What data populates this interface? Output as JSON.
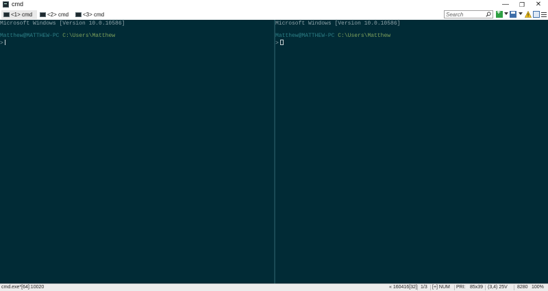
{
  "window": {
    "title": "cmd",
    "controls": {
      "minimize": "—",
      "maximize": "❐",
      "close": "✕"
    }
  },
  "tabs": [
    {
      "label": "<1> cmd",
      "active": true
    },
    {
      "label": "<2> cmd",
      "active": false
    },
    {
      "label": "<3> cmd",
      "active": false
    }
  ],
  "toolbar": {
    "search_placeholder": "Search",
    "icons": [
      "new-console-icon",
      "dropdown-arrow-icon",
      "save-icon",
      "dropdown-arrow-icon",
      "warning-icon",
      "panels-icon",
      "menu-icon"
    ],
    "warning_glyph": "⚠"
  },
  "panes": {
    "left": {
      "banner": "Microsoft Windows [Version 10.0.10586]",
      "user_host": "Matthew@MATTHEW-PC",
      "path": "C:\\Users\\Matthew",
      "prompt": ">"
    },
    "right": {
      "banner": "Microsoft Windows [Version 10.0.10586]",
      "user_host": "Matthew@MATTHEW-PC",
      "path": "C:\\Users\\Matthew",
      "prompt": ">"
    }
  },
  "statusbar": {
    "process": "cmd.exe*[64]:10020",
    "position": "« 160416[32]",
    "console_index": "1/3",
    "mode": "[+] NUM",
    "priority": "PRI:",
    "size": "85x39",
    "cursor": "(3,4) 25V",
    "pid": "8280",
    "zoom": "100%"
  },
  "colors": {
    "console_bg": "#012b36",
    "text": "#8fa3a9",
    "user": "#2d7f86",
    "path": "#7fa25c"
  }
}
